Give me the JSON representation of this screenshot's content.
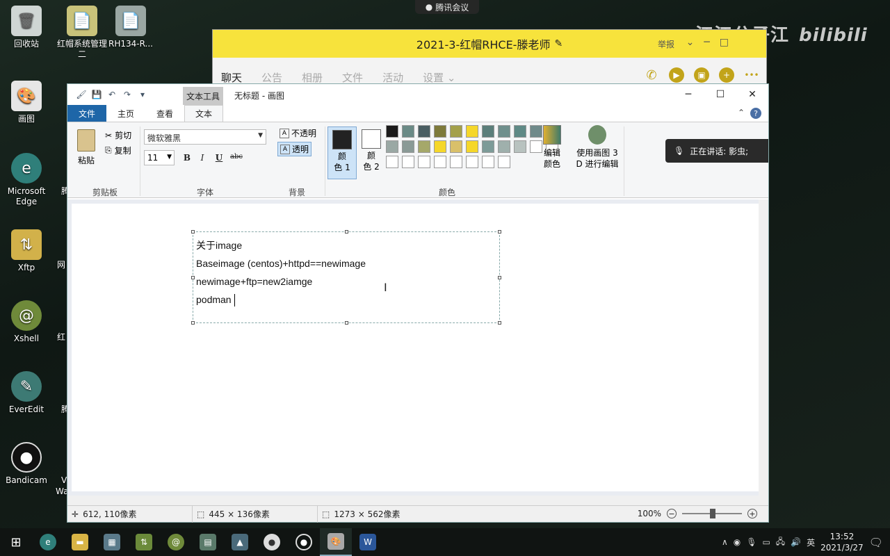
{
  "top_indicator": "腾讯会议",
  "desktop": {
    "icons": [
      {
        "label": "回收站"
      },
      {
        "label": "红帽系统管理二"
      },
      {
        "label": "RH134-R..."
      },
      {
        "label": "画图"
      },
      {
        "label": "Microsoft Edge"
      },
      {
        "label": "Xftp"
      },
      {
        "label": "Xshell"
      },
      {
        "label": "EverEdit"
      },
      {
        "label": "Bandicam"
      }
    ],
    "partial": [
      "腾",
      "网",
      "红",
      "腾",
      "V",
      "Wa"
    ]
  },
  "chat": {
    "title": "2021-3-红帽RHCE-滕老师",
    "report": "举报",
    "tabs": [
      "聊天",
      "公告",
      "相册",
      "文件",
      "活动",
      "设置"
    ]
  },
  "watermark": {
    "text": "江江公子江",
    "brand": "bilibili"
  },
  "speaking": "正在讲话: 影虫;",
  "paint": {
    "context_tab": "文本工具",
    "doc_title": "无标题 - 画图",
    "tabs": {
      "file": "文件",
      "home": "主页",
      "view": "查看",
      "text": "文本"
    },
    "clipboard": {
      "paste": "粘贴",
      "cut": "剪切",
      "copy": "复制",
      "label": "剪贴板"
    },
    "font": {
      "family": "微软雅黑",
      "size": "11",
      "bold": "B",
      "italic": "I",
      "underline": "U",
      "strike": "abc",
      "label": "字体"
    },
    "background": {
      "opaque": "不透明",
      "transparent": "透明",
      "label": "背景"
    },
    "colors": {
      "color1_line1": "颜",
      "color1_line2": "色 1",
      "color2_line1": "颜",
      "color2_line2": "色 2",
      "edit_line1": "编辑",
      "edit_line2": "颜色",
      "p3d_line1": "使用画图 3",
      "p3d_line2": "D 进行编辑",
      "label": "颜色",
      "color1": "#222222",
      "color2": "#ffffff",
      "palette": [
        "#1a1a1a",
        "#6a8a86",
        "#4a5e62",
        "#7d7a3a",
        "#a3a04a",
        "#f5d72a",
        "#5b7e7a",
        "#6f8f8c",
        "#5f8a86",
        "#6f8a8a",
        "#f4f4f4",
        "#9aa8a4",
        "#8a9a96",
        "#a5a86a",
        "#f5d72a",
        "#d9c06a",
        "#f5d72a",
        "#7d9b98",
        "#9fb0ac",
        "#b8c2bf",
        "#ffffff",
        "#ffffff",
        "#ffffff",
        "#ffffff",
        "#ffffff",
        "#ffffff",
        "#ffffff",
        "#ffffff",
        "#ffffff",
        "#ffffff"
      ]
    },
    "text_lines": [
      "关于image",
      "Baseimage (centos)+httpd==newimage",
      "newimage+ftp=new2iamge",
      "podman"
    ],
    "status": {
      "cursor": "612, 110像素",
      "selection": "445 × 136像素",
      "canvas": "1273 × 562像素",
      "zoom": "100%"
    }
  },
  "taskbar": {
    "ime": "英",
    "time": "13:52",
    "date": "2021/3/27",
    "tray_caret": "∧"
  }
}
